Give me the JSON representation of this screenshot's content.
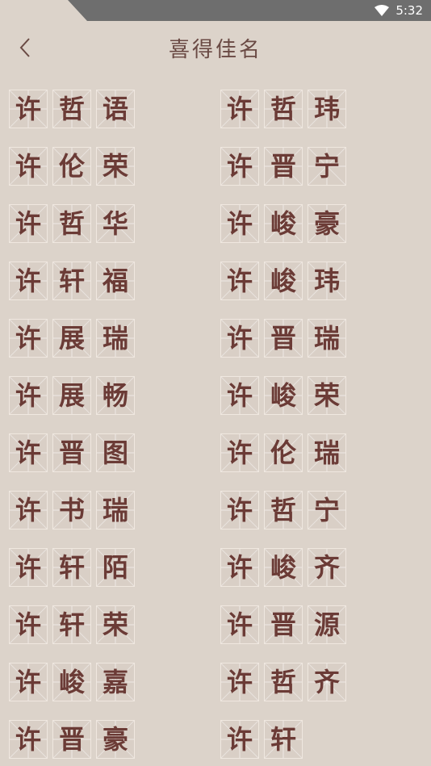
{
  "status": {
    "time": "5:32",
    "wifi_icon": "wifi-icon"
  },
  "header": {
    "title": "喜得佳名",
    "back_icon": "chevron-left-icon"
  },
  "names": [
    [
      "许",
      "哲",
      "语"
    ],
    [
      "许",
      "哲",
      "玮"
    ],
    [
      "许",
      "伦",
      "荣"
    ],
    [
      "许",
      "晋",
      "宁"
    ],
    [
      "许",
      "哲",
      "华"
    ],
    [
      "许",
      "峻",
      "豪"
    ],
    [
      "许",
      "轩",
      "福"
    ],
    [
      "许",
      "峻",
      "玮"
    ],
    [
      "许",
      "展",
      "瑞"
    ],
    [
      "许",
      "晋",
      "瑞"
    ],
    [
      "许",
      "展",
      "畅"
    ],
    [
      "许",
      "峻",
      "荣"
    ],
    [
      "许",
      "晋",
      "图"
    ],
    [
      "许",
      "伦",
      "瑞"
    ],
    [
      "许",
      "书",
      "瑞"
    ],
    [
      "许",
      "哲",
      "宁"
    ],
    [
      "许",
      "轩",
      "陌"
    ],
    [
      "许",
      "峻",
      "齐"
    ],
    [
      "许",
      "轩",
      "荣"
    ],
    [
      "许",
      "晋",
      "源"
    ],
    [
      "许",
      "峻",
      "嘉"
    ],
    [
      "许",
      "哲",
      "齐"
    ],
    [
      "许",
      "晋",
      "豪"
    ],
    [
      "许",
      "轩"
    ]
  ]
}
